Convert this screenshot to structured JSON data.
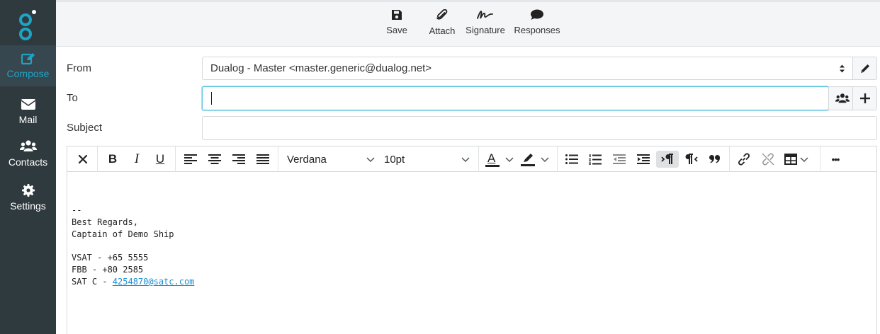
{
  "nav": {
    "compose": "Compose",
    "mail": "Mail",
    "contacts": "Contacts",
    "settings": "Settings"
  },
  "toolbar": {
    "save": "Save",
    "attach": "Attach",
    "signature": "Signature",
    "responses": "Responses"
  },
  "form": {
    "from_label": "From",
    "from_value": "Dualog - Master <master.generic@dualog.net>",
    "to_label": "To",
    "to_value": "",
    "subject_label": "Subject",
    "subject_value": ""
  },
  "editor": {
    "font_family": "Verdana",
    "font_size": "10pt",
    "bold": "B",
    "italic": "I",
    "underline": "U",
    "text_color": "A",
    "more": "•••",
    "body": {
      "line1": "--",
      "line2": "Best Regards,",
      "line3": "Captain of Demo Ship",
      "line4": "VSAT - +65 5555",
      "line5": "FBB - +80 2585",
      "line6_prefix": "SAT C - ",
      "link": "4254870@satc.com"
    }
  },
  "colors": {
    "sidebar": "#2f3a3f",
    "accent": "#1fa3c4",
    "focus_border": "#57c3e0",
    "link": "#1a8fd1"
  }
}
